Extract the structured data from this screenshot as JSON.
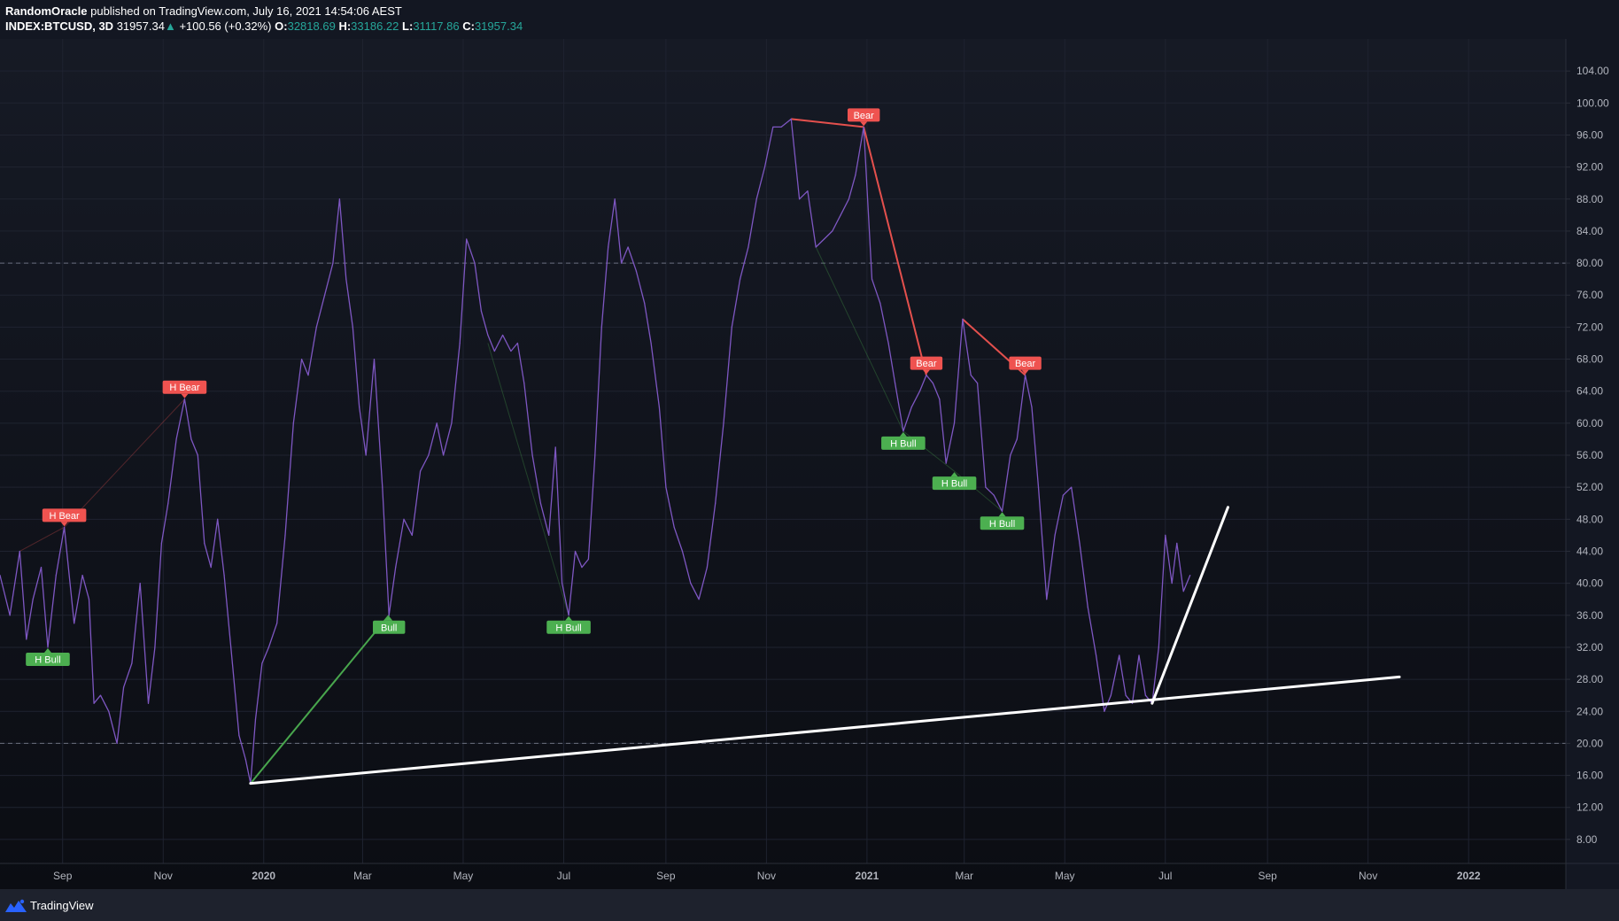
{
  "header": {
    "author": "RandomOracle",
    "published": "published on TradingView.com, July 16, 2021 14:54:06 AEST",
    "symbol": "INDEX:BTCUSD, 3D",
    "last": "31957.34",
    "change_arrow": "▲",
    "change": "+100.56 (+0.32%)",
    "o_label": "O:",
    "o_value": "32818.69",
    "h_label": "H:",
    "h_value": "33186.22",
    "l_label": "L:",
    "l_value": "31117.86",
    "c_label": "C:",
    "c_value": "31957.34"
  },
  "footer": {
    "brand": "TradingView",
    "logo_icon": "tradingview-logo-icon"
  },
  "colors": {
    "background": "#131722",
    "rsi_line": "#7e57c2",
    "bear": "#ef5350",
    "bull": "#4caf50",
    "trendline": "#ffffff",
    "axis_text": "#b2b5be",
    "grid": "#1f2330"
  },
  "chart_data": {
    "type": "line",
    "title": "",
    "xlabel": "",
    "ylabel": "",
    "ylim": [
      5,
      108
    ],
    "xlim": [
      "2019-07-25",
      "2022-03-01"
    ],
    "y_ticks": [
      "8.00",
      "12.00",
      "16.00",
      "20.00",
      "24.00",
      "28.00",
      "32.00",
      "36.00",
      "40.00",
      "44.00",
      "48.00",
      "52.00",
      "56.00",
      "60.00",
      "64.00",
      "68.00",
      "72.00",
      "76.00",
      "80.00",
      "84.00",
      "88.00",
      "92.00",
      "96.00",
      "100.00",
      "104.00"
    ],
    "x_ticks": [
      {
        "label": "Sep",
        "date": "2019-09-01",
        "bold": false
      },
      {
        "label": "Nov",
        "date": "2019-11-01",
        "bold": false
      },
      {
        "label": "2020",
        "date": "2020-01-01",
        "bold": true
      },
      {
        "label": "Mar",
        "date": "2020-03-01",
        "bold": false
      },
      {
        "label": "May",
        "date": "2020-05-01",
        "bold": false
      },
      {
        "label": "Jul",
        "date": "2020-07-01",
        "bold": false
      },
      {
        "label": "Sep",
        "date": "2020-09-01",
        "bold": false
      },
      {
        "label": "Nov",
        "date": "2020-11-01",
        "bold": false
      },
      {
        "label": "2021",
        "date": "2021-01-01",
        "bold": true
      },
      {
        "label": "Mar",
        "date": "2021-03-01",
        "bold": false
      },
      {
        "label": "May",
        "date": "2021-05-01",
        "bold": false
      },
      {
        "label": "Jul",
        "date": "2021-07-01",
        "bold": false
      },
      {
        "label": "Sep",
        "date": "2021-09-01",
        "bold": false
      },
      {
        "label": "Nov",
        "date": "2021-11-01",
        "bold": false
      },
      {
        "label": "2022",
        "date": "2022-01-01",
        "bold": true
      }
    ],
    "levels": [
      80,
      20
    ],
    "grid": true,
    "series": [
      {
        "values": [
          [
            "2019-07-25",
            41
          ],
          [
            "2019-07-31",
            36
          ],
          [
            "2019-08-06",
            44
          ],
          [
            "2019-08-10",
            33
          ],
          [
            "2019-08-14",
            38
          ],
          [
            "2019-08-19",
            42
          ],
          [
            "2019-08-23",
            32
          ],
          [
            "2019-08-28",
            41
          ],
          [
            "2019-09-02",
            47
          ],
          [
            "2019-09-08",
            35
          ],
          [
            "2019-09-13",
            41
          ],
          [
            "2019-09-17",
            38
          ],
          [
            "2019-09-20",
            25
          ],
          [
            "2019-09-24",
            26
          ],
          [
            "2019-09-29",
            24
          ],
          [
            "2019-10-04",
            20
          ],
          [
            "2019-10-08",
            27
          ],
          [
            "2019-10-13",
            30
          ],
          [
            "2019-10-18",
            40
          ],
          [
            "2019-10-23",
            25
          ],
          [
            "2019-10-27",
            32
          ],
          [
            "2019-10-31",
            45
          ],
          [
            "2019-11-04",
            50
          ],
          [
            "2019-11-09",
            58
          ],
          [
            "2019-11-14",
            63
          ],
          [
            "2019-11-18",
            58
          ],
          [
            "2019-11-22",
            56
          ],
          [
            "2019-11-26",
            45
          ],
          [
            "2019-11-30",
            42
          ],
          [
            "2019-12-04",
            48
          ],
          [
            "2019-12-08",
            41
          ],
          [
            "2019-12-13",
            30
          ],
          [
            "2019-12-17",
            21
          ],
          [
            "2019-12-21",
            18
          ],
          [
            "2019-12-24",
            15
          ],
          [
            "2019-12-27",
            23
          ],
          [
            "2019-12-31",
            30
          ],
          [
            "2020-01-04",
            32
          ],
          [
            "2020-01-09",
            35
          ],
          [
            "2020-01-14",
            46
          ],
          [
            "2020-01-19",
            60
          ],
          [
            "2020-01-24",
            68
          ],
          [
            "2020-01-28",
            66
          ],
          [
            "2020-02-02",
            72
          ],
          [
            "2020-02-07",
            76
          ],
          [
            "2020-02-12",
            80
          ],
          [
            "2020-02-16",
            88
          ],
          [
            "2020-02-20",
            78
          ],
          [
            "2020-02-24",
            72
          ],
          [
            "2020-02-28",
            62
          ],
          [
            "2020-03-03",
            56
          ],
          [
            "2020-03-08",
            68
          ],
          [
            "2020-03-13",
            52
          ],
          [
            "2020-03-17",
            36
          ],
          [
            "2020-03-21",
            42
          ],
          [
            "2020-03-26",
            48
          ],
          [
            "2020-03-31",
            46
          ],
          [
            "2020-04-05",
            54
          ],
          [
            "2020-04-10",
            56
          ],
          [
            "2020-04-15",
            60
          ],
          [
            "2020-04-19",
            56
          ],
          [
            "2020-04-24",
            60
          ],
          [
            "2020-04-29",
            70
          ],
          [
            "2020-05-03",
            83
          ],
          [
            "2020-05-08",
            80
          ],
          [
            "2020-05-12",
            74
          ],
          [
            "2020-05-16",
            71
          ],
          [
            "2020-05-20",
            69
          ],
          [
            "2020-05-25",
            71
          ],
          [
            "2020-05-30",
            69
          ],
          [
            "2020-06-03",
            70
          ],
          [
            "2020-06-07",
            65
          ],
          [
            "2020-06-12",
            56
          ],
          [
            "2020-06-17",
            50
          ],
          [
            "2020-06-22",
            46
          ],
          [
            "2020-06-26",
            57
          ],
          [
            "2020-06-30",
            40
          ],
          [
            "2020-07-04",
            36
          ],
          [
            "2020-07-08",
            44
          ],
          [
            "2020-07-12",
            42
          ],
          [
            "2020-07-16",
            43
          ],
          [
            "2020-07-20",
            56
          ],
          [
            "2020-07-24",
            72
          ],
          [
            "2020-07-28",
            82
          ],
          [
            "2020-08-01",
            88
          ],
          [
            "2020-08-05",
            80
          ],
          [
            "2020-08-09",
            82
          ],
          [
            "2020-08-14",
            79
          ],
          [
            "2020-08-19",
            75
          ],
          [
            "2020-08-23",
            70
          ],
          [
            "2020-08-28",
            62
          ],
          [
            "2020-09-01",
            52
          ],
          [
            "2020-09-06",
            47
          ],
          [
            "2020-09-11",
            44
          ],
          [
            "2020-09-16",
            40
          ],
          [
            "2020-09-21",
            38
          ],
          [
            "2020-09-26",
            42
          ],
          [
            "2020-10-01",
            50
          ],
          [
            "2020-10-06",
            60
          ],
          [
            "2020-10-11",
            72
          ],
          [
            "2020-10-16",
            78
          ],
          [
            "2020-10-21",
            82
          ],
          [
            "2020-10-26",
            88
          ],
          [
            "2020-10-31",
            92
          ],
          [
            "2020-11-05",
            97
          ],
          [
            "2020-11-10",
            97
          ],
          [
            "2020-11-16",
            98
          ],
          [
            "2020-11-21",
            88
          ],
          [
            "2020-11-26",
            89
          ],
          [
            "2020-12-01",
            82
          ],
          [
            "2020-12-06",
            83
          ],
          [
            "2020-12-11",
            84
          ],
          [
            "2020-12-16",
            86
          ],
          [
            "2020-12-21",
            88
          ],
          [
            "2020-12-25",
            91
          ],
          [
            "2020-12-30",
            97
          ],
          [
            "2021-01-04",
            78
          ],
          [
            "2021-01-09",
            75
          ],
          [
            "2021-01-14",
            70
          ],
          [
            "2021-01-18",
            65
          ],
          [
            "2021-01-23",
            59
          ],
          [
            "2021-01-28",
            62
          ],
          [
            "2021-02-02",
            64
          ],
          [
            "2021-02-06",
            66
          ],
          [
            "2021-02-10",
            65
          ],
          [
            "2021-02-14",
            63
          ],
          [
            "2021-02-18",
            55
          ],
          [
            "2021-02-23",
            60
          ],
          [
            "2021-02-28",
            73
          ],
          [
            "2021-03-05",
            66
          ],
          [
            "2021-03-09",
            65
          ],
          [
            "2021-03-14",
            52
          ],
          [
            "2021-03-19",
            51
          ],
          [
            "2021-03-24",
            49
          ],
          [
            "2021-03-29",
            56
          ],
          [
            "2021-04-02",
            58
          ],
          [
            "2021-04-07",
            66
          ],
          [
            "2021-04-11",
            62
          ],
          [
            "2021-04-15",
            52
          ],
          [
            "2021-04-20",
            38
          ],
          [
            "2021-04-25",
            46
          ],
          [
            "2021-04-30",
            51
          ],
          [
            "2021-05-05",
            52
          ],
          [
            "2021-05-10",
            45
          ],
          [
            "2021-05-15",
            37
          ],
          [
            "2021-05-20",
            31
          ],
          [
            "2021-05-25",
            24
          ],
          [
            "2021-05-29",
            26
          ],
          [
            "2021-06-03",
            31
          ],
          [
            "2021-06-07",
            26
          ],
          [
            "2021-06-11",
            25
          ],
          [
            "2021-06-15",
            31
          ],
          [
            "2021-06-19",
            26
          ],
          [
            "2021-06-23",
            25
          ],
          [
            "2021-06-27",
            32
          ],
          [
            "2021-07-01",
            46
          ],
          [
            "2021-07-05",
            40
          ],
          [
            "2021-07-08",
            45
          ],
          [
            "2021-07-12",
            39
          ],
          [
            "2021-07-16",
            41
          ]
        ]
      }
    ],
    "trendlines": [
      {
        "from": [
          "2019-12-24",
          15
        ],
        "to": [
          "2021-11-20",
          28.3
        ],
        "style": "thick-white"
      },
      {
        "from": [
          "2021-06-23",
          25
        ],
        "to": [
          "2021-08-08",
          49.5
        ],
        "style": "thick-white"
      }
    ],
    "divergences": [
      {
        "kind": "bear",
        "from": [
          "2019-08-06",
          44
        ],
        "to": [
          "2019-09-02",
          47
        ],
        "faint": true
      },
      {
        "kind": "bear",
        "from": [
          "2019-09-02",
          47
        ],
        "to": [
          "2019-11-14",
          63
        ],
        "faint": true
      },
      {
        "kind": "bull",
        "from": [
          "2019-12-24",
          15
        ],
        "to": [
          "2020-03-17",
          36
        ],
        "faint": false
      },
      {
        "kind": "bull",
        "from": [
          "2020-05-16",
          70
        ],
        "to": [
          "2020-07-04",
          36
        ],
        "faint": true
      },
      {
        "kind": "bear",
        "from": [
          "2020-11-16",
          98
        ],
        "to": [
          "2020-12-30",
          97
        ],
        "faint": false
      },
      {
        "kind": "bear",
        "from": [
          "2020-12-30",
          97
        ],
        "to": [
          "2021-02-06",
          66
        ],
        "faint": false
      },
      {
        "kind": "bull",
        "from": [
          "2020-12-01",
          82
        ],
        "to": [
          "2021-01-23",
          59
        ],
        "faint": true
      },
      {
        "kind": "bull",
        "from": [
          "2021-01-23",
          59
        ],
        "to": [
          "2021-02-23",
          54
        ],
        "faint": true
      },
      {
        "kind": "bull",
        "from": [
          "2021-02-23",
          54
        ],
        "to": [
          "2021-03-24",
          49
        ],
        "faint": true
      },
      {
        "kind": "bear",
        "from": [
          "2021-02-28",
          73
        ],
        "to": [
          "2021-04-07",
          66
        ],
        "faint": false
      }
    ],
    "labels": [
      {
        "text": "H Bear",
        "kind": "bear",
        "date": "2019-09-02",
        "value": 47,
        "place": "above"
      },
      {
        "text": "H Bear",
        "kind": "bear",
        "date": "2019-11-14",
        "value": 63,
        "place": "above"
      },
      {
        "text": "H Bull",
        "kind": "bull",
        "date": "2019-08-23",
        "value": 32,
        "place": "below"
      },
      {
        "text": "Bull",
        "kind": "bull",
        "date": "2020-03-17",
        "value": 36,
        "place": "below"
      },
      {
        "text": "H Bull",
        "kind": "bull",
        "date": "2020-07-04",
        "value": 36,
        "place": "below"
      },
      {
        "text": "Bear",
        "kind": "bear",
        "date": "2020-12-30",
        "value": 97,
        "place": "above"
      },
      {
        "text": "Bear",
        "kind": "bear",
        "date": "2021-02-06",
        "value": 66,
        "place": "above"
      },
      {
        "text": "H Bull",
        "kind": "bull",
        "date": "2021-01-23",
        "value": 59,
        "place": "below"
      },
      {
        "text": "H Bull",
        "kind": "bull",
        "date": "2021-02-23",
        "value": 54,
        "place": "below"
      },
      {
        "text": "Bear",
        "kind": "bear",
        "date": "2021-04-07",
        "value": 66,
        "place": "above"
      },
      {
        "text": "H Bull",
        "kind": "bull",
        "date": "2021-03-24",
        "value": 49,
        "place": "below"
      }
    ]
  }
}
